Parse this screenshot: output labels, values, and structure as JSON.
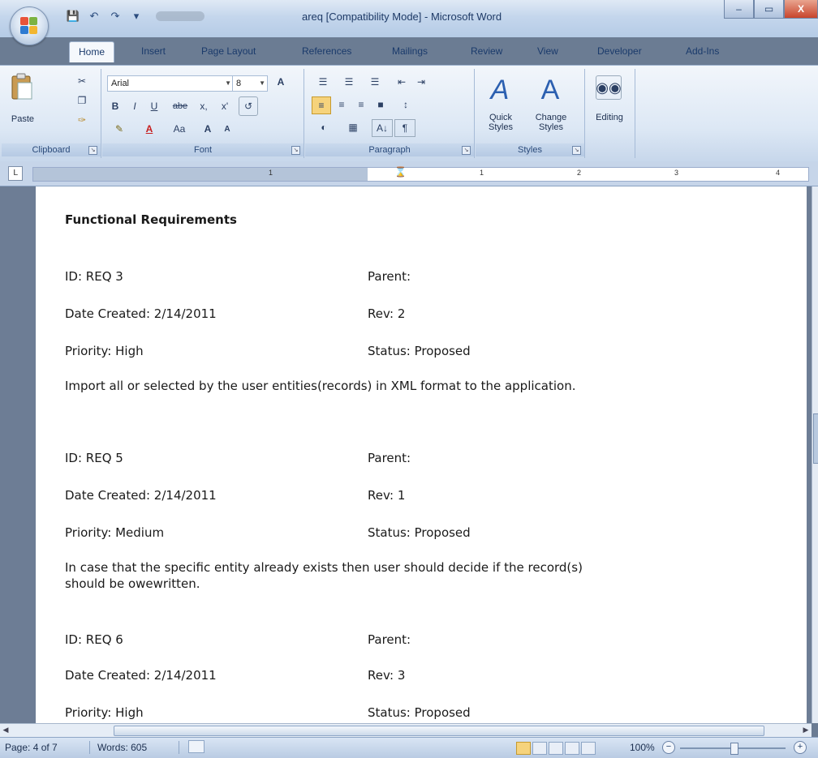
{
  "window": {
    "title": "areq [Compatibility Mode] - Microsoft Word",
    "minimize": "–",
    "maximize": "▭",
    "close": "X"
  },
  "tabs": [
    "Home",
    "Insert",
    "Page Layout",
    "References",
    "Mailings",
    "Review",
    "View",
    "Developer",
    "Add-Ins"
  ],
  "ribbon": {
    "clipboard": {
      "label": "Clipboard",
      "paste": "Paste"
    },
    "font": {
      "label": "Font",
      "font_name": "Arial",
      "font_size": "8",
      "bold": "B",
      "italic": "I",
      "underline": "U",
      "strike": "abe",
      "subscript": "x,",
      "superscript": "x'",
      "change_case": "Aa",
      "grow": "A",
      "shrink": "A"
    },
    "paragraph": {
      "label": "Paragraph",
      "sort": "A↓",
      "pilcrow": "¶"
    },
    "styles": {
      "label": "Styles",
      "quick": "Quick\nStyles",
      "change": "Change\nStyles"
    },
    "editing": {
      "label": "Editing"
    }
  },
  "ruler": {
    "numbers": [
      "1",
      "1",
      "2",
      "3",
      "4"
    ]
  },
  "document": {
    "heading": "Functional Requirements",
    "requirements": [
      {
        "id": "ID: REQ 3",
        "parent": "Parent:",
        "date": "Date Created: 2/14/2011",
        "rev": "Rev: 2",
        "priority": "Priority: High",
        "status": "Status: Proposed",
        "description": "Import all or selected by the user entities(records) in XML format  to the application."
      },
      {
        "id": "ID: REQ 5",
        "parent": "Parent:",
        "date": "Date Created: 2/14/2011",
        "rev": "Rev: 1",
        "priority": "Priority: Medium",
        "status": "Status: Proposed",
        "description": "In case that the specific entity already exists then user should decide if the record(s) should be owewritten."
      },
      {
        "id": "ID: REQ 6",
        "parent": "Parent:",
        "date": "Date Created: 2/14/2011",
        "rev": "Rev: 3",
        "priority": "Priority: High",
        "status": "Status: Proposed",
        "description": ""
      }
    ]
  },
  "statusbar": {
    "page": "Page: 4 of 7",
    "words": "Words: 605",
    "zoom": "100%",
    "zoom_out": "−",
    "zoom_in": "+"
  },
  "colors": {
    "accent": "#1a3a6b",
    "ribbon_bg": "#dde8f5",
    "active_view": "#f6d37c"
  },
  "icons": [
    "office-logo-icon",
    "save-icon",
    "undo-icon",
    "redo-icon",
    "paste-icon",
    "cut-icon",
    "copy-icon",
    "format-painter-icon",
    "binoculars-icon",
    "quick-styles-icon",
    "change-styles-icon"
  ]
}
